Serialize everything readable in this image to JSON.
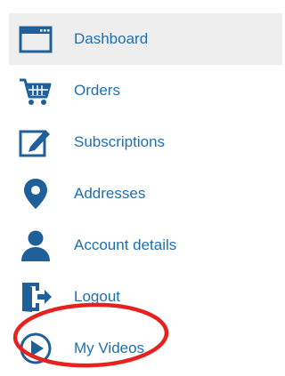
{
  "nav": {
    "items": [
      {
        "label": "Dashboard",
        "icon": "dashboard-icon",
        "active": true
      },
      {
        "label": "Orders",
        "icon": "cart-icon",
        "active": false
      },
      {
        "label": "Subscriptions",
        "icon": "edit-icon",
        "active": false
      },
      {
        "label": "Addresses",
        "icon": "map-pin-icon",
        "active": false
      },
      {
        "label": "Account details",
        "icon": "user-icon",
        "active": false
      },
      {
        "label": "Logout",
        "icon": "logout-icon",
        "active": false
      },
      {
        "label": "My Videos",
        "icon": "play-circle-icon",
        "active": false
      }
    ]
  },
  "colors": {
    "accent": "#1f6fae",
    "icon": "#1f5f9a",
    "active_background": "#eeeeee",
    "highlight": "#e6221f"
  }
}
